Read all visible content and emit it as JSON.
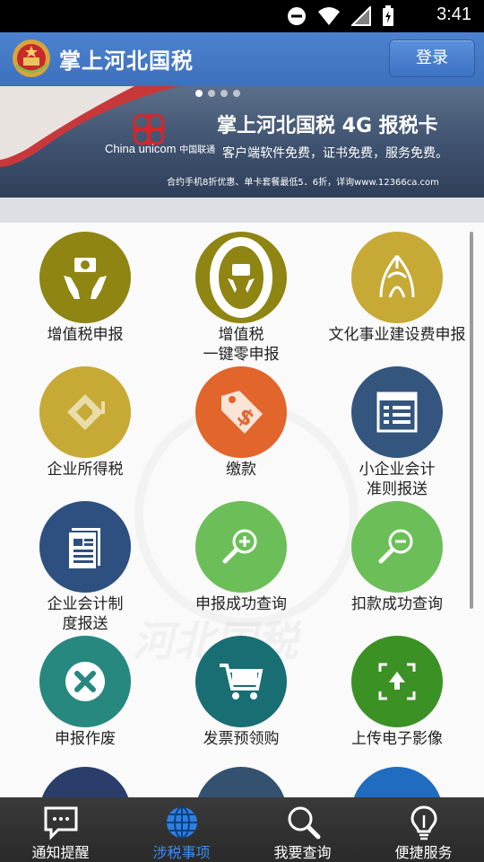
{
  "status_bar": {
    "time": "3:41"
  },
  "header": {
    "title": "掌上河北国税",
    "login_label": "登录"
  },
  "banner": {
    "brand_en": "China unicom",
    "brand_cn": "中国联通",
    "headline": "掌上河北国税 4G 报税卡",
    "subline": "客户端软件免费，证书免费，服务免费。",
    "fineprint": "合约手机8折优惠、单卡套餐最低5．6折，详询www.12366ca.com"
  },
  "tiles": [
    {
      "line1": "增值税申报",
      "line2": "",
      "color": "#8e8512",
      "icon": "money-hands-icon"
    },
    {
      "line1": "增值税",
      "line2": "一键零申报",
      "color": "#8e8512",
      "icon": "zero-declare-icon"
    },
    {
      "line1": "文化事业建设费申报",
      "line2": "",
      "color": "#c6aa35",
      "icon": "culture-icon"
    },
    {
      "line1": "企业所得税",
      "line2": "",
      "color": "#c6aa35",
      "icon": "exchange-icon"
    },
    {
      "line1": "缴款",
      "line2": "",
      "color": "#e2652c",
      "icon": "price-tag-icon"
    },
    {
      "line1": "小企业会计",
      "line2": "准则报送",
      "color": "#33557e",
      "icon": "list-window-icon"
    },
    {
      "line1": "企业会计制",
      "line2": "度报送",
      "color": "#2d5080",
      "icon": "document-icon"
    },
    {
      "line1": "申报成功查询",
      "line2": "",
      "color": "#6cbf58",
      "icon": "zoom-in-icon"
    },
    {
      "line1": "扣款成功查询",
      "line2": "",
      "color": "#6cbf58",
      "icon": "zoom-out-icon"
    },
    {
      "line1": "申报作废",
      "line2": "",
      "color": "#27887f",
      "icon": "cancel-icon"
    },
    {
      "line1": "发票预领购",
      "line2": "",
      "color": "#186e72",
      "icon": "cart-icon"
    },
    {
      "line1": "上传电子影像",
      "line2": "",
      "color": "#3c9125",
      "icon": "upload-icon"
    }
  ],
  "tabs": [
    {
      "label": "通知提醒",
      "icon": "message-icon",
      "active": false
    },
    {
      "label": "涉税事项",
      "icon": "globe-icon",
      "active": true
    },
    {
      "label": "我要查询",
      "icon": "search-icon",
      "active": false
    },
    {
      "label": "便捷服务",
      "icon": "lightbulb-icon",
      "active": false
    }
  ]
}
